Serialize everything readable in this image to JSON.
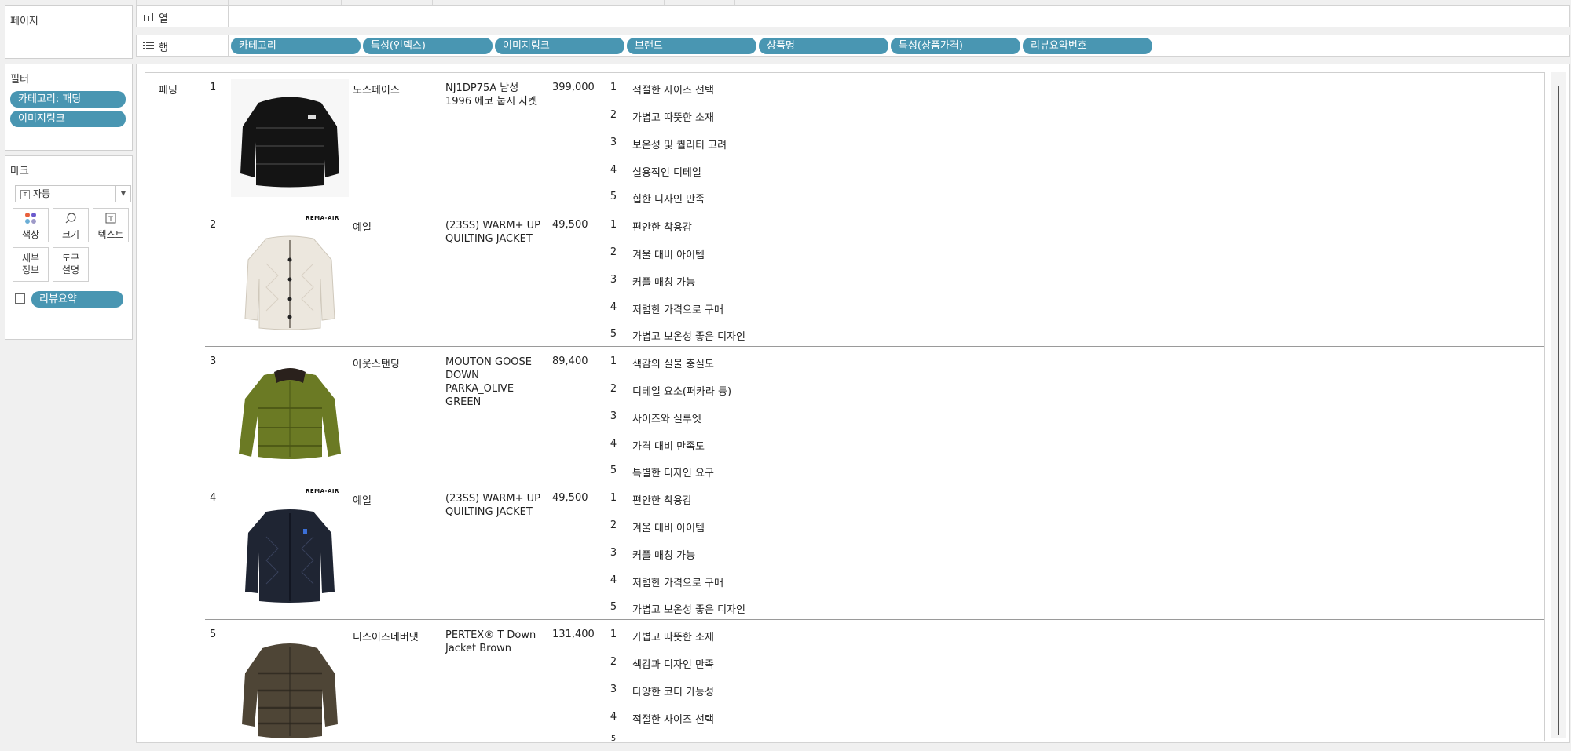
{
  "shelves": {
    "columns": {
      "label": "열",
      "icon": "columns-icon",
      "pills": []
    },
    "rows": {
      "label": "행",
      "icon": "rows-icon",
      "pills": [
        "카테고리",
        "특성(인덱스)",
        "이미지링크",
        "브랜드",
        "상품명",
        "특성(상품가격)",
        "리뷰요약번호"
      ]
    }
  },
  "pages": {
    "title": "페이지"
  },
  "filters": {
    "title": "필터",
    "items": [
      "카테고리: 패딩",
      "이미지링크"
    ]
  },
  "marks": {
    "title": "마크",
    "type": "자동",
    "buttons": {
      "color": "색상",
      "size": "크기",
      "text": "텍스트",
      "detail_1": "세부",
      "detail_2": "정보",
      "tooltip_1": "도구",
      "tooltip_2": "설명"
    },
    "text_field": "리뷰요약"
  },
  "view": {
    "category": "패딩",
    "rows": [
      {
        "rank": "1",
        "brand": "노스페이스",
        "product": "NJ1DP75A 남성 1996 에코 눕시 자켓",
        "price": "399,000",
        "image": "black-puffer-jacket",
        "reviews": [
          "적절한 사이즈 선택",
          "가볍고 따뜻한 소재",
          "보온성 및 퀄리티 고려",
          "실용적인 디테일",
          "힙한 디자인 만족"
        ]
      },
      {
        "rank": "2",
        "brand": "예일",
        "product": "(23SS) WARM+ UP QUILTING JACKET",
        "price": "49,500",
        "image": "ivory-quilted-jacket",
        "badge": "REMA-AIR",
        "reviews": [
          "편안한 착용감",
          "겨울 대비 아이템",
          "커플 매칭 가능",
          "저렴한 가격으로 구매",
          "가볍고 보온성 좋은 디자인"
        ]
      },
      {
        "rank": "3",
        "brand": "아웃스탠딩",
        "product": "MOUTON GOOSE DOWN PARKA_OLIVE GREEN",
        "price": "89,400",
        "image": "olive-down-parka",
        "reviews": [
          "색감의 실물 충실도",
          "디테일 요소(퍼카라 등)",
          "사이즈와 실루엣",
          "가격 대비 만족도",
          "특별한 디자인 요구"
        ]
      },
      {
        "rank": "4",
        "brand": "예일",
        "product": "(23SS) WARM+ UP QUILTING JACKET",
        "price": "49,500",
        "image": "navy-quilted-jacket",
        "badge": "REMA-AIR",
        "reviews": [
          "편안한 착용감",
          "겨울 대비 아이템",
          "커플 매칭 가능",
          "저렴한 가격으로 구매",
          "가볍고 보온성 좋은 디자인"
        ]
      },
      {
        "rank": "5",
        "brand": "디스이즈네버댓",
        "product": "PERTEX® T Down Jacket Brown",
        "price": "131,400",
        "image": "brown-puffer-jacket",
        "reviews": [
          "가볍고 따뜻한 소재",
          "색감과 디자인 만족",
          "다양한 코디 가능성",
          "적절한 사이즈 선택"
        ]
      }
    ],
    "review_numbers": [
      "1",
      "2",
      "3",
      "4",
      "5"
    ]
  },
  "colors": {
    "pill": "#4996b2",
    "background": "#f0f0f0"
  }
}
